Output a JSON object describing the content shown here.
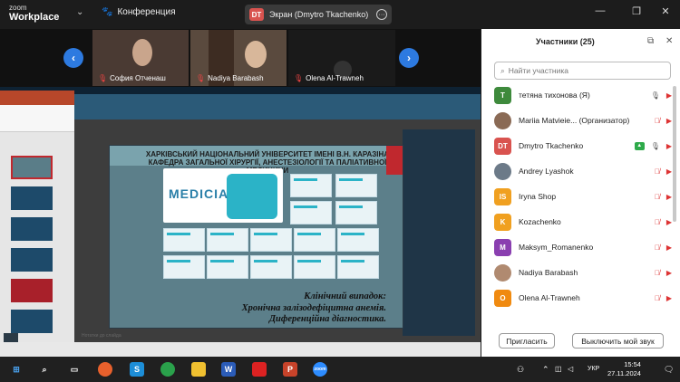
{
  "app": {
    "logo_line1": "zoom",
    "logo_line2": "Workplace",
    "conference": "Конференция"
  },
  "screen_share": {
    "badge": "DT",
    "label": "Экран (Dmytro Tkachenko)"
  },
  "video_strip": [
    {
      "name": "София Отченаш"
    },
    {
      "name": "Nadiya Barabash"
    },
    {
      "name": "Olena Al-Trawneh"
    }
  ],
  "slide": {
    "title": "ХАРКІВСЬКИЙ НАЦІОНАЛЬНИЙ УНІВЕРСИТЕТ ІМЕНІ В.Н. КАРАЗІНА КАФЕДРА ЗАГАЛЬНОЇ ХІРУРГІЇ, АНЕСТЕЗІОЛОГІЇ ТА ПАЛІАТИВНОЇ МЕДИЦИНИ",
    "brand": "MEDICIA",
    "line1": "Клінічний випадок:",
    "line2": "Хронічна залізодефіцитна анемія.",
    "line3": "Диференційна діагностика.",
    "notes": "Нотатки до слайда"
  },
  "panel": {
    "title": "Участники (25)",
    "search_placeholder": "Найти участника",
    "participants": [
      {
        "initial": "Т",
        "color": "#3e8a3c",
        "name": "тетяна тихонова (Я)",
        "mic_muted": false,
        "cam_muted": true
      },
      {
        "initial": "",
        "color": "#8a6a55",
        "name": "Mariia Matvieie... (Организатор)",
        "mic_muted": true,
        "cam_muted": true
      },
      {
        "initial": "DT",
        "color": "#d9534f",
        "name": "Dmytro Tkachenko",
        "mic_muted": false,
        "cam_muted": true,
        "sharing": true
      },
      {
        "initial": "",
        "color": "#6c7a88",
        "name": "Andrey Lyashok",
        "mic_muted": true,
        "cam_muted": true
      },
      {
        "initial": "IS",
        "color": "#f0a020",
        "name": "Iryna Shop",
        "mic_muted": true,
        "cam_muted": true
      },
      {
        "initial": "K",
        "color": "#f0a020",
        "name": "Kozachenko",
        "mic_muted": true,
        "cam_muted": true
      },
      {
        "initial": "M",
        "color": "#8a3fb0",
        "name": "Maksym_Romanenko",
        "mic_muted": true,
        "cam_muted": true
      },
      {
        "initial": "",
        "color": "#b08a70",
        "name": "Nadiya Barabash",
        "mic_muted": true,
        "cam_muted": true
      },
      {
        "initial": "O",
        "color": "#f08a10",
        "name": "Olena Al-Trawneh",
        "mic_muted": true,
        "cam_muted": true
      }
    ],
    "invite_label": "Пригласить",
    "mute_label": "Выключить мой звук"
  },
  "taskbar": {
    "lang": "УКР",
    "time": "15:54",
    "date": "27.11.2024"
  }
}
